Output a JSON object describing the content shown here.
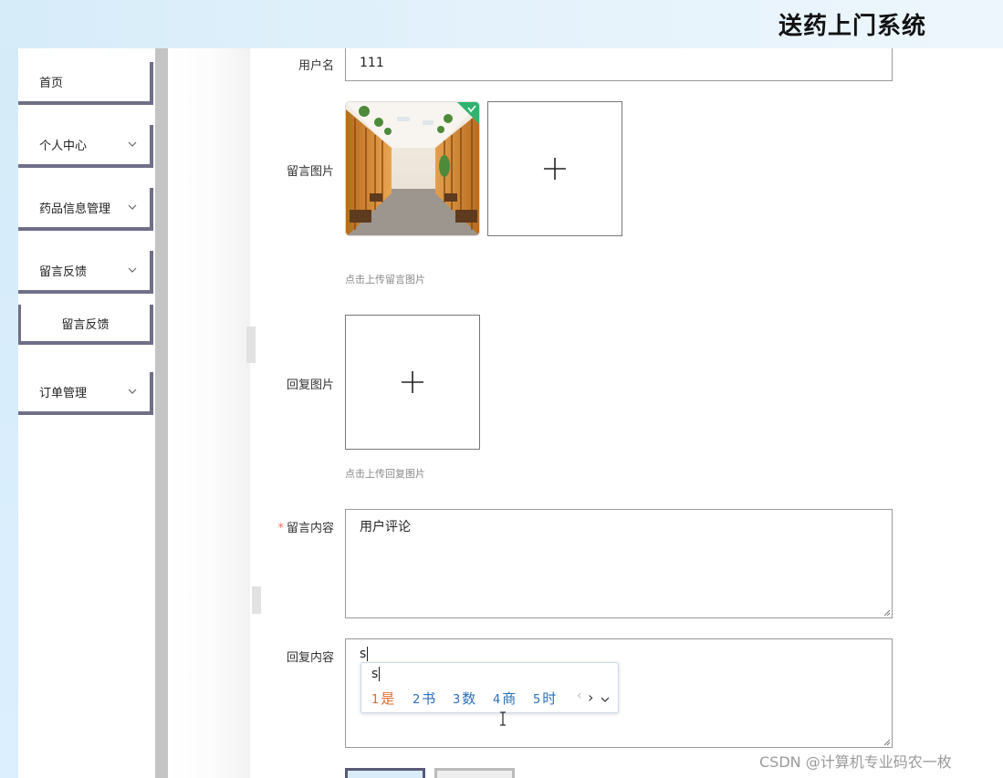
{
  "header": {
    "title": "送药上门系统"
  },
  "sidebar": {
    "items": [
      {
        "label": "首页",
        "has_chevron": false
      },
      {
        "label": "个人中心",
        "has_chevron": true
      },
      {
        "label": "药品信息管理",
        "has_chevron": true
      },
      {
        "label": "留言反馈",
        "has_chevron": true
      },
      {
        "label": "留言反馈",
        "is_sub": true
      },
      {
        "label": "订单管理",
        "has_chevron": true
      }
    ]
  },
  "form": {
    "username": {
      "label": "用户名",
      "value": "111"
    },
    "message_image": {
      "label": "留言图片",
      "hint": "点击上传留言图片"
    },
    "reply_image": {
      "label": "回复图片",
      "hint": "点击上传回复图片"
    },
    "message_content": {
      "label": "留言内容",
      "required_mark": "*",
      "value": "用户评论"
    },
    "reply_content": {
      "label": "回复内容",
      "value": "s"
    }
  },
  "ime": {
    "composition": "s",
    "candidates": [
      {
        "num": "1",
        "text": "是"
      },
      {
        "num": "2",
        "text": "书"
      },
      {
        "num": "3",
        "text": "数"
      },
      {
        "num": "4",
        "text": "商"
      },
      {
        "num": "5",
        "text": "时"
      }
    ],
    "prev": "‹",
    "next": "›"
  },
  "watermark": "CSDN @计算机专业码农一枚",
  "colors": {
    "menu_border": "#6f6f88",
    "header_bg": "#d6ecf9",
    "check_badge": "#2fb36f"
  }
}
